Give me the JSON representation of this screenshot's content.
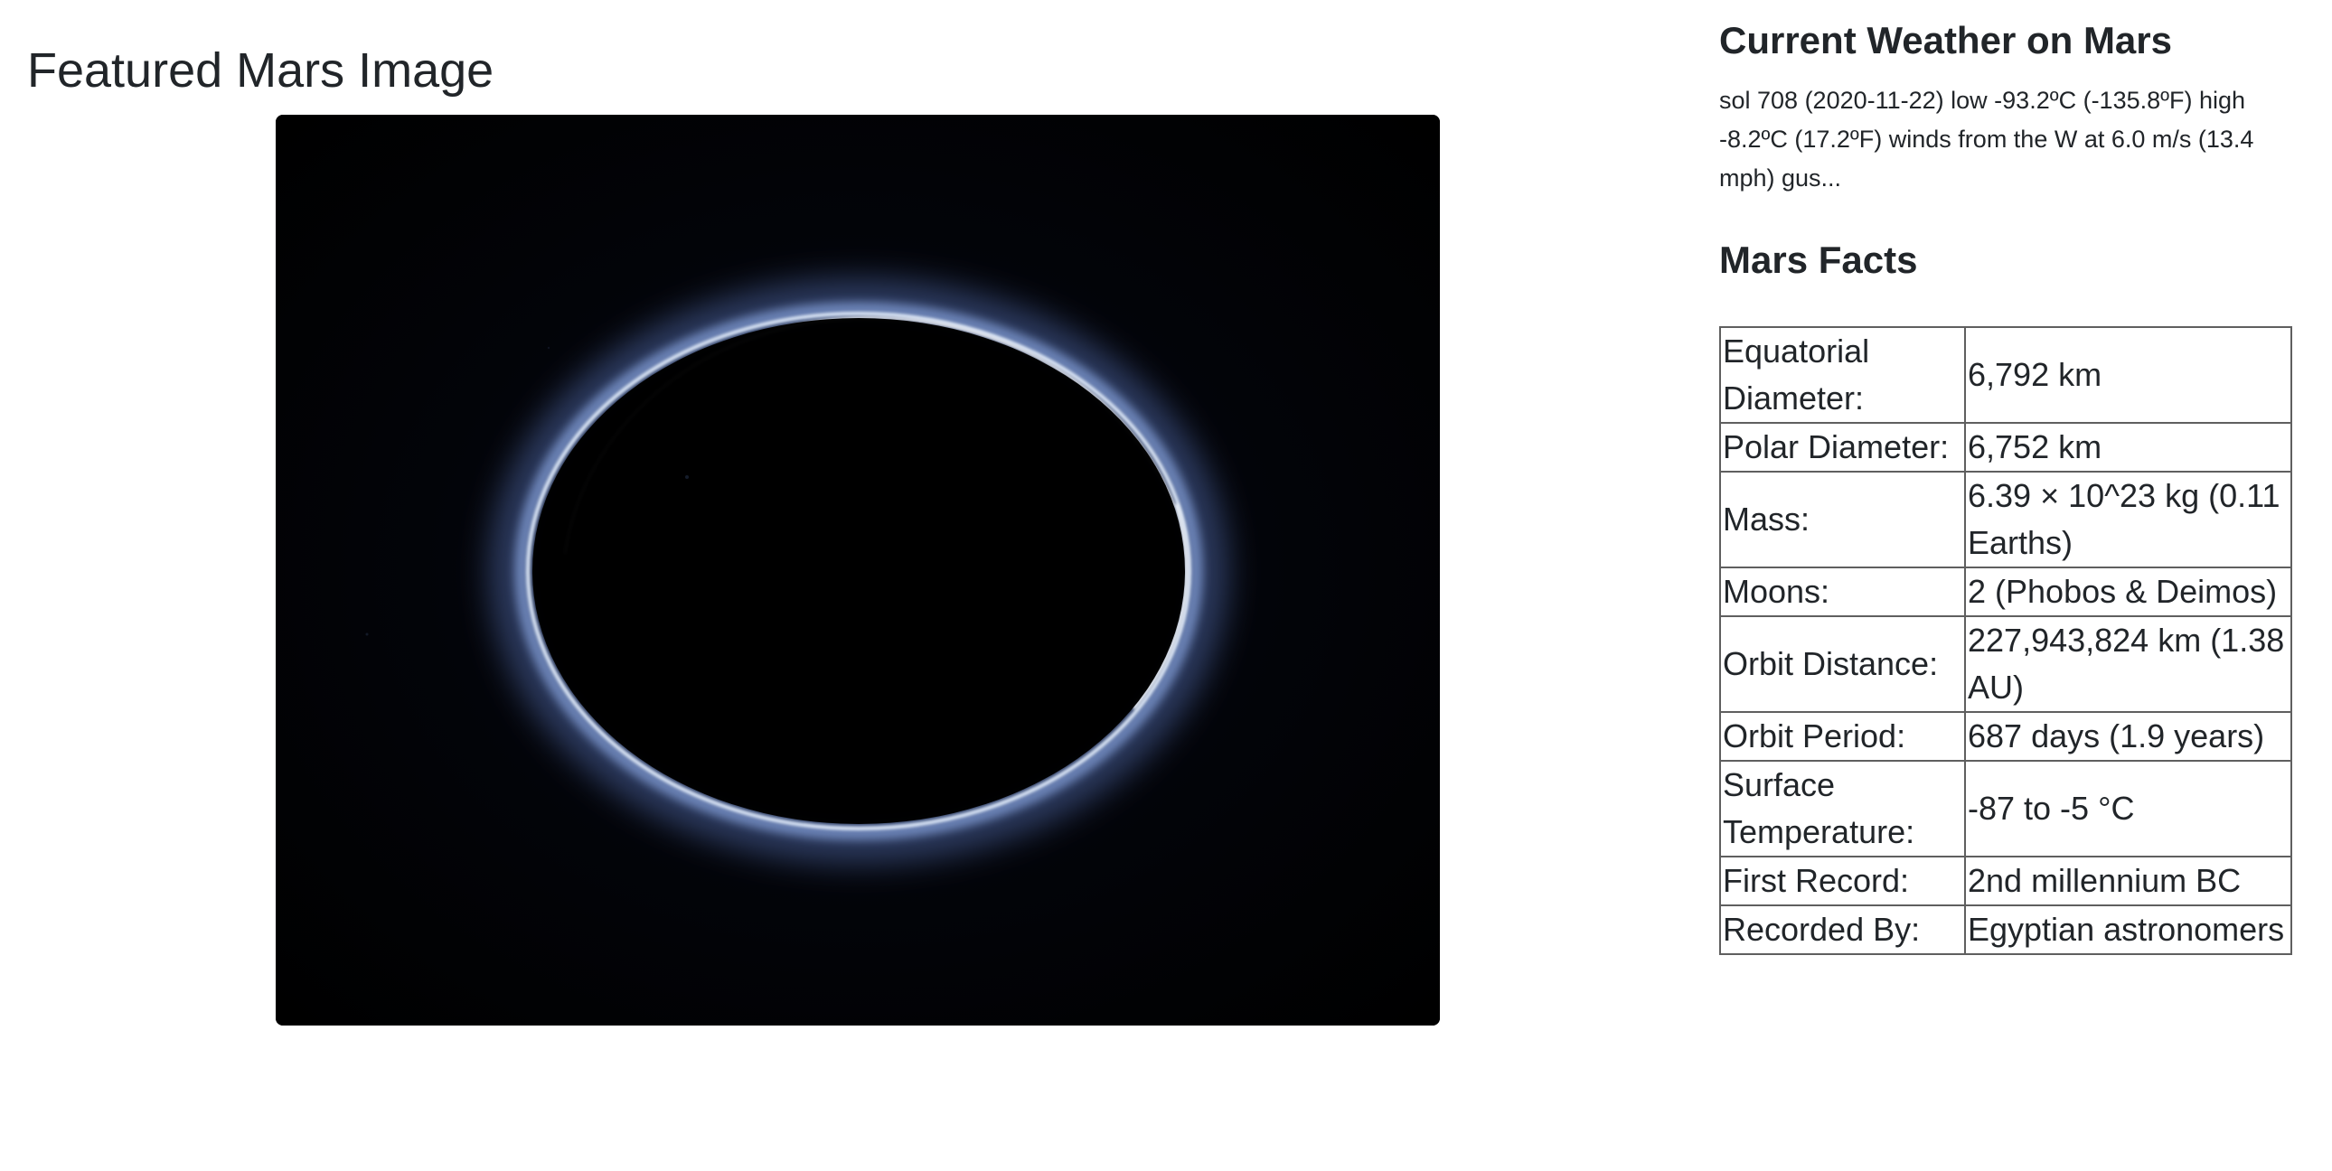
{
  "featured": {
    "title": "Featured Mars Image",
    "image_alt": "Planet atmosphere haze ring against black space",
    "image_colors": {
      "background": "#000000",
      "ring": "#ffffff",
      "glow": "#8fb4ff"
    }
  },
  "weather": {
    "title": "Current Weather on Mars",
    "text": "sol 708 (2020-11-22) low -93.2ºC (-135.8ºF) high -8.2ºC (17.2ºF) winds from the W at 6.0 m/s (13.4 mph) gus..."
  },
  "facts": {
    "title": "Mars Facts",
    "rows": [
      {
        "label": "Equatorial Diameter:",
        "value": "6,792 km"
      },
      {
        "label": "Polar Diameter:",
        "value": "6,752 km"
      },
      {
        "label": "Mass:",
        "value": "6.39 × 10^23 kg (0.11 Earths)"
      },
      {
        "label": "Moons:",
        "value": "2 (Phobos & Deimos)"
      },
      {
        "label": "Orbit Distance:",
        "value": "227,943,824 km (1.38 AU)"
      },
      {
        "label": "Orbit Period:",
        "value": "687 days (1.9 years)"
      },
      {
        "label": "Surface Temperature:",
        "value": "-87 to -5 °C"
      },
      {
        "label": "First Record:",
        "value": "2nd millennium BC"
      },
      {
        "label": "Recorded By:",
        "value": "Egyptian astronomers"
      }
    ]
  }
}
